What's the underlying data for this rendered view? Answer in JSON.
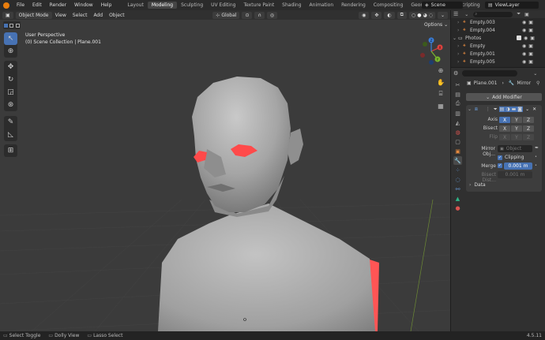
{
  "menu": {
    "file": "File",
    "edit": "Edit",
    "render": "Render",
    "window": "Window",
    "help": "Help"
  },
  "workspaces": [
    "Layout",
    "Modeling",
    "Sculpting",
    "UV Editing",
    "Texture Paint",
    "Shading",
    "Animation",
    "Rendering",
    "Compositing",
    "Geometry Nodes",
    "Scripting"
  ],
  "active_workspace": "Modeling",
  "scene": "Scene",
  "view_layer": "ViewLayer",
  "viewport": {
    "mode": "Object Mode",
    "menus": [
      "View",
      "Select",
      "Add",
      "Object"
    ],
    "orientation": "Global",
    "options_label": "Options",
    "overlay_title": "User Perspective",
    "overlay_collection": "(0) Scene Collection | Plane.001"
  },
  "gizmo": {
    "x": "X",
    "y": "Y",
    "z": "Z"
  },
  "outliner": {
    "search_placeholder": "",
    "rows": [
      {
        "name": "Empty.003",
        "type": "empty"
      },
      {
        "name": "Empty.004",
        "type": "empty"
      },
      {
        "name": "Photos",
        "type": "collection"
      },
      {
        "name": "Empty",
        "type": "empty"
      },
      {
        "name": "Empty.001",
        "type": "empty"
      },
      {
        "name": "Empty.005",
        "type": "empty"
      }
    ]
  },
  "properties": {
    "object_name": "Plane.001",
    "modifier_breadcrumb": "Mirror",
    "add_modifier": "Add Modifier",
    "axis_label": "Axis",
    "bisect_label": "Bisect",
    "flip_label": "Flip",
    "axes": [
      "X",
      "Y",
      "Z"
    ],
    "mirror_object_label": "Mirror Obj...",
    "mirror_object_placeholder": "Object",
    "clipping_label": "Clipping",
    "merge_label": "Merge",
    "merge_value": "0.001 m",
    "bisect_dist_label": "Bisect Dist...",
    "bisect_dist_value": "0.001 m",
    "data_label": "Data"
  },
  "status": {
    "select_toggle": "Select Toggle",
    "dolly_view": "Dolly View",
    "lasso_select": "Lasso Select",
    "version": "4.5.11"
  },
  "colors": {
    "accent": "#4772b3",
    "x_axis": "#e0423e",
    "y_axis": "#7bb72d",
    "z_axis": "#3a7fdc",
    "mirror_red": "#ff5555",
    "skin": "#9d9d9d"
  }
}
